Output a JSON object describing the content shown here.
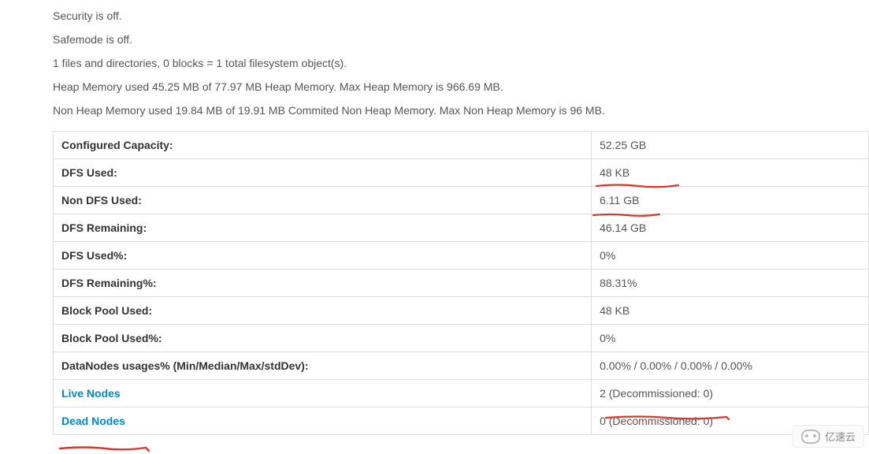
{
  "status": {
    "security": "Security is off.",
    "safemode": "Safemode is off.",
    "files": "1 files and directories, 0 blocks = 1 total filesystem object(s).",
    "heap": "Heap Memory used 45.25 MB of 77.97 MB Heap Memory. Max Heap Memory is 966.69 MB.",
    "nonheap": "Non Heap Memory used 19.84 MB of 19.91 MB Commited Non Heap Memory. Max Non Heap Memory is 96 MB."
  },
  "rows": {
    "configured_capacity": {
      "label": "Configured Capacity:",
      "value": "52.25 GB"
    },
    "dfs_used": {
      "label": "DFS Used:",
      "value": "48 KB"
    },
    "non_dfs_used": {
      "label": "Non DFS Used:",
      "value": "6.11 GB"
    },
    "dfs_remaining": {
      "label": "DFS Remaining:",
      "value": "46.14 GB"
    },
    "dfs_used_pct": {
      "label": "DFS Used%:",
      "value": "0%"
    },
    "dfs_remaining_pct": {
      "label": "DFS Remaining%:",
      "value": "88.31%"
    },
    "block_pool_used": {
      "label": "Block Pool Used:",
      "value": "48 KB"
    },
    "block_pool_used_pct": {
      "label": "Block Pool Used%:",
      "value": "0%"
    },
    "datanodes_usages": {
      "label": "DataNodes usages% (Min/Median/Max/stdDev):",
      "value": "0.00% / 0.00% / 0.00% / 0.00%"
    },
    "live_nodes": {
      "label": "Live Nodes",
      "value": "2 (Decommissioned: 0)"
    },
    "dead_nodes": {
      "label": "Dead Nodes",
      "value": "0 (Decommissioned: 0)"
    }
  },
  "watermark": "亿速云",
  "annotation_color": "#d43a2f"
}
